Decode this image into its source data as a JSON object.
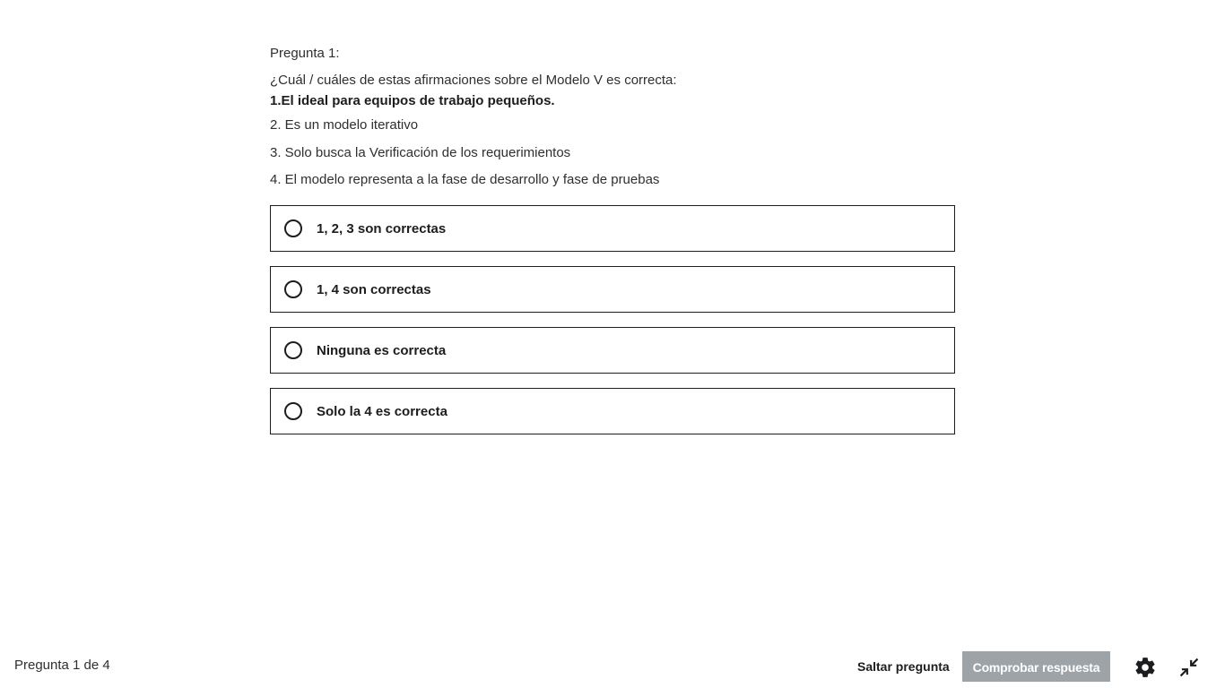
{
  "question": {
    "number_label": "Pregunta 1:",
    "prompt": "¿Cuál / cuáles de estas afirmaciones sobre el Modelo V es correcta:",
    "statement_1": "1.El ideal para equipos de trabajo pequeños.",
    "statement_2": "2. Es un modelo iterativo",
    "statement_3": "3. Solo busca la Verificación de los requerimientos",
    "statement_4": "4. El modelo representa a la fase de desarrollo y fase de pruebas"
  },
  "options": [
    {
      "label": "1, 2, 3 son correctas"
    },
    {
      "label": "1, 4 son correctas"
    },
    {
      "label": "Ninguna es correcta"
    },
    {
      "label": "Solo la 4 es correcta"
    }
  ],
  "footer": {
    "progress": "Pregunta 1 de 4",
    "skip_label": "Saltar pregunta",
    "check_label": "Comprobar respuesta",
    "settings_icon": "gear-icon",
    "collapse_icon": "collapse-arrows-icon"
  },
  "colors": {
    "text": "#1c1d1f",
    "disabled_button": "#9da3a7",
    "background": "#ffffff"
  }
}
